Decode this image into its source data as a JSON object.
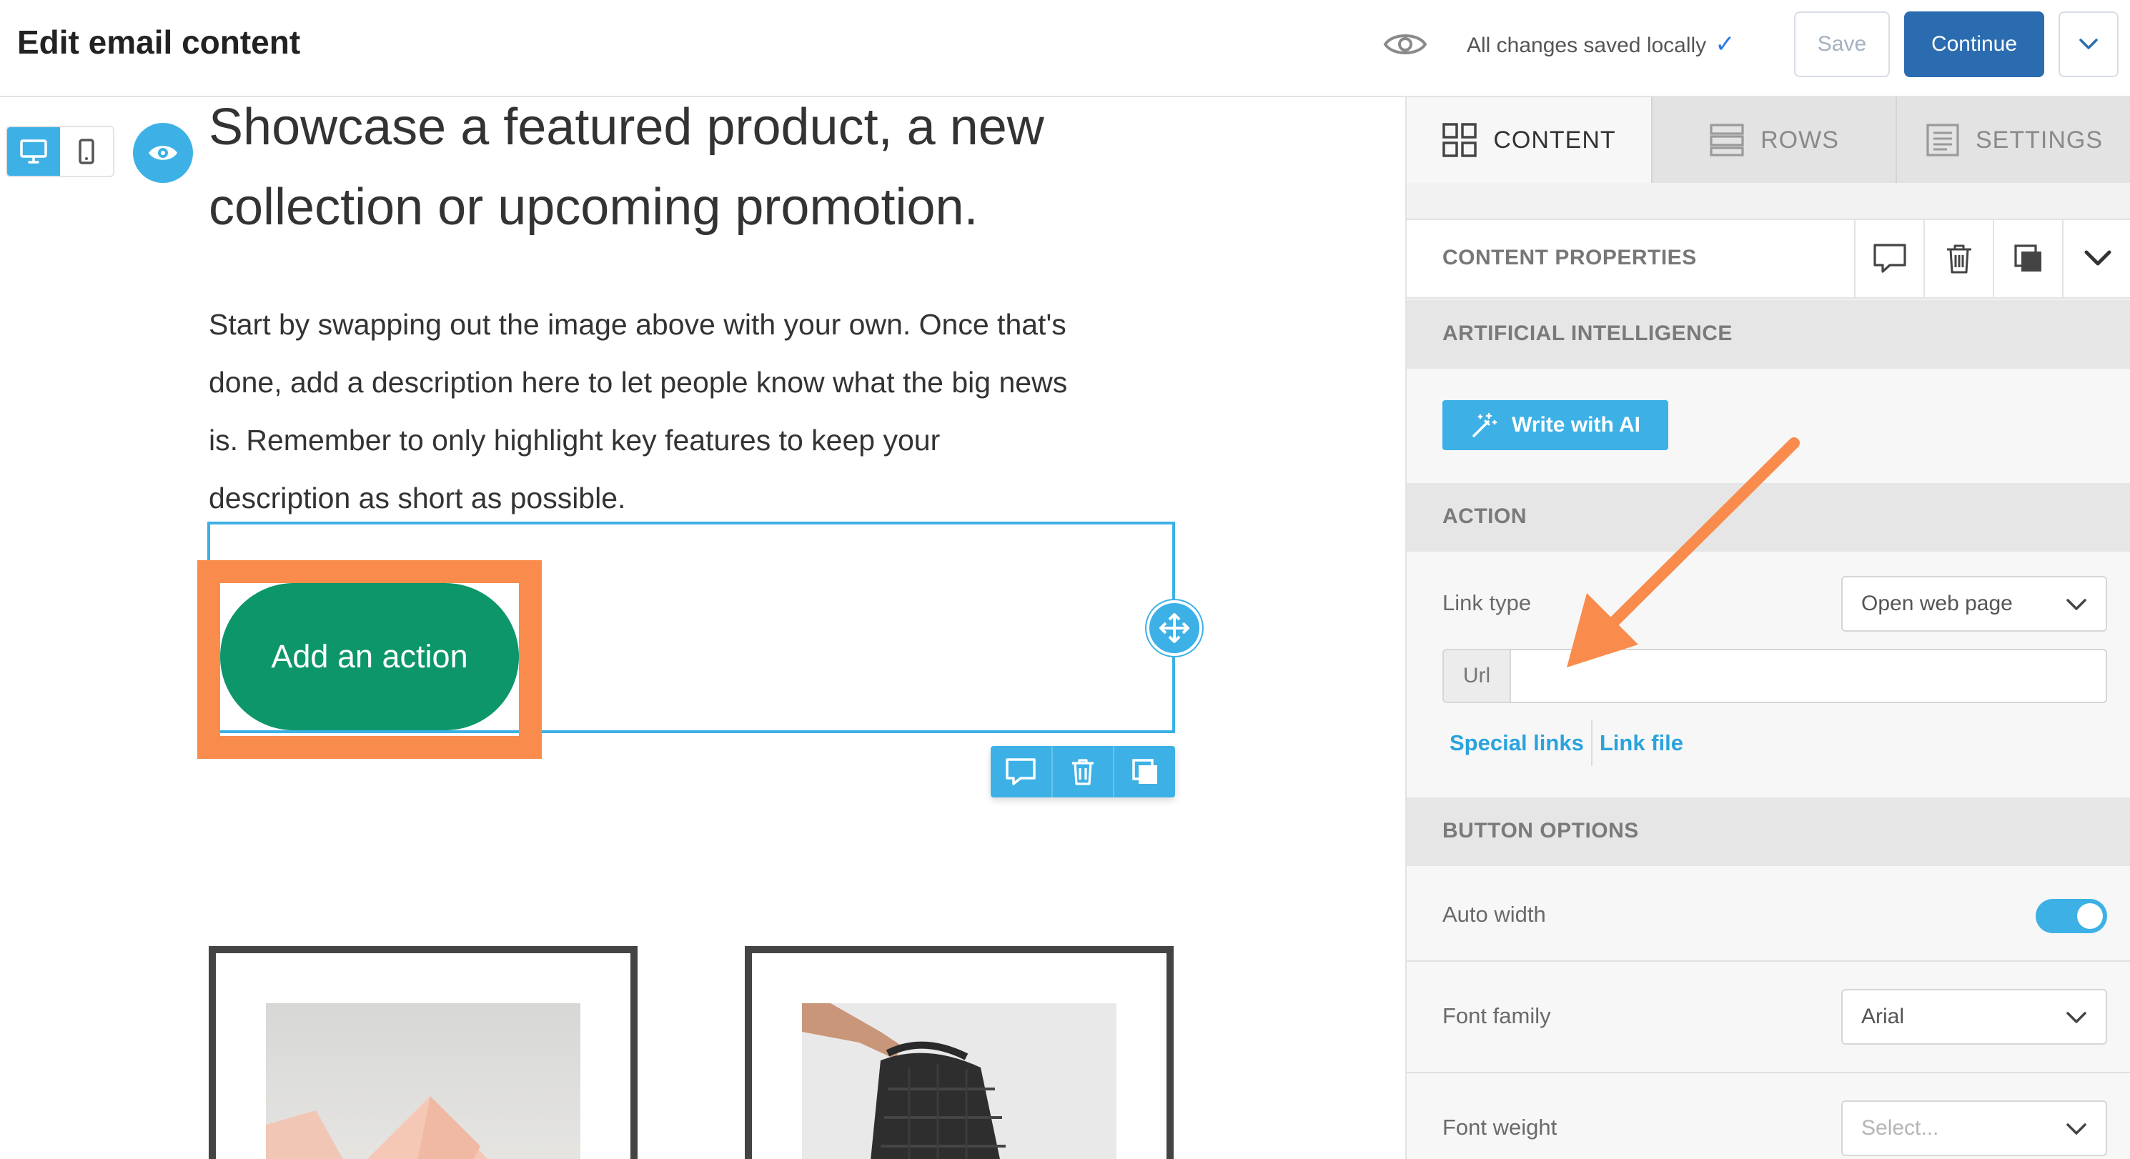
{
  "header": {
    "title": "Edit email content",
    "saved_status": "All changes saved locally",
    "save_label": "Save",
    "continue_label": "Continue"
  },
  "canvas": {
    "headline_line1": "Showcase a featured product, a new",
    "headline_line2": "collection or upcoming promotion.",
    "body_lines": [
      "Start by swapping out the image above with your own. Once that's",
      "done, add a description here to let people know what the big news",
      "is. Remember to only highlight key features to keep your",
      "description as short as possible."
    ],
    "button_label": "Add an action",
    "button_color": "#0c9669",
    "highlight_color": "#f98c4d",
    "accent_color": "#3db1e6"
  },
  "panel": {
    "tabs": [
      {
        "label": "CONTENT",
        "icon": "grid-icon",
        "active": true
      },
      {
        "label": "ROWS",
        "icon": "rows-icon",
        "active": false
      },
      {
        "label": "SETTINGS",
        "icon": "settings-list-icon",
        "active": false
      }
    ],
    "properties_title": "CONTENT PROPERTIES",
    "ai_section": "ARTIFICIAL INTELLIGENCE",
    "ai_button": "Write with AI",
    "action_section": "ACTION",
    "link_type_label": "Link type",
    "link_type_value": "Open web page",
    "url_prefix": "Url",
    "url_value": "",
    "special_links": "Special links",
    "link_file": "Link file",
    "button_options_section": "BUTTON OPTIONS",
    "auto_width_label": "Auto width",
    "auto_width_on": true,
    "font_family_label": "Font family",
    "font_family_value": "Arial",
    "font_weight_label": "Font weight",
    "font_weight_placeholder": "Select..."
  }
}
